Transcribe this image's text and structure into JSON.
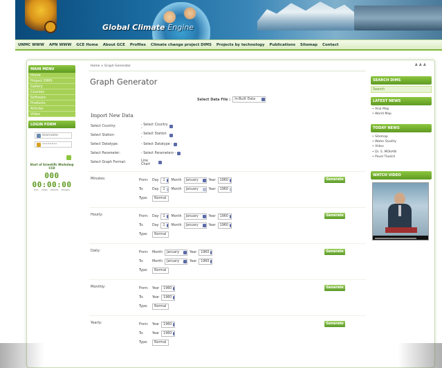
{
  "header": {
    "site_title": "Global Climate",
    "site_title_suffix": "Engine"
  },
  "nav": [
    "UNMC WWW",
    "APN WWW",
    "GCE Home",
    "About GCE",
    "Profiles",
    "Climate change project DIMS",
    "Projects by technology",
    "Publications",
    "Sitemap",
    "Contact"
  ],
  "breadcrumb": "Home > Graph Generator",
  "page_title": "Graph Generator",
  "data_file": {
    "label": "Select Data File :",
    "value": "In-Built Data"
  },
  "import": {
    "title": "Import New Data",
    "fields": [
      {
        "label": "Select Country:",
        "value": "- Select Country -"
      },
      {
        "label": "Select Station:",
        "value": "- Select Station -"
      },
      {
        "label": "Select Datatype:",
        "value": "- Select Datatype -"
      },
      {
        "label": "Select Parameter:",
        "value": "- Select Parameters -"
      },
      {
        "label": "Select Graph Format:",
        "value": "Line Chart"
      }
    ]
  },
  "labels": {
    "from": "From:",
    "to": "To:",
    "type": "Type:",
    "day": "Day",
    "month": "Month",
    "year": "Year",
    "generate": "Generate"
  },
  "values": {
    "day": "1",
    "month": "January",
    "year": "1960",
    "type": "Normal"
  },
  "sections": [
    "Minutes:",
    "Hourly:",
    "Daily:",
    "Monthly:",
    "Yearly:"
  ],
  "left": {
    "main_menu": "MAIN MENU",
    "menu_items": [
      "Home",
      "Project DIMS",
      "Gallery",
      "Courses",
      "Software",
      "Products",
      "Articles",
      "Video"
    ],
    "login_form": "LOGIN FORM",
    "username_placeholder": "Username",
    "password_placeholder": "••••••••",
    "workshop_title": "Start of Scientific Workshop CCD",
    "counter": "000 00:00:00",
    "counter_labels": [
      "DAYS",
      "HOURS",
      "MINUTES",
      "SECONDS"
    ]
  },
  "right": {
    "font_size_controls": "A A A",
    "search_title": "SEARCH DIMS",
    "search_placeholder": "Search",
    "latest_news_title": "LATEST NEWS",
    "latest_news": [
      "Asia Map",
      "World Map"
    ],
    "today_news_title": "TODAY NEWS",
    "today_news": [
      "Sitemap",
      "Water Quality",
      "Video",
      "Dr. S. MOHAN",
      "Pavel Tkalich"
    ],
    "watch_video_title": "WATCH VIDEO"
  },
  "colors": {
    "accent": "#8cc63f",
    "accent_dark": "#5e9a22",
    "header": "#0a4a7a"
  },
  "icons": {
    "select": "chevron-down-icon",
    "username": "user-icon",
    "password": "key-icon"
  }
}
